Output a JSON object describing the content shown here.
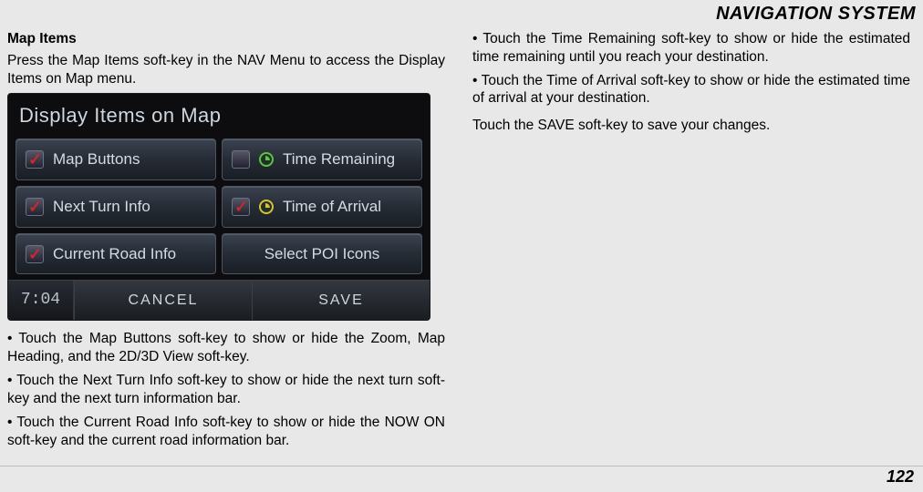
{
  "header": {
    "title": "NAVIGATION SYSTEM"
  },
  "page_number": "122",
  "left": {
    "heading": "Map Items",
    "intro": "Press the Map Items soft-key in the NAV Menu to access the Display Items on Map menu.",
    "b1": "• Touch the Map Buttons soft-key to show or hide the Zoom, Map Heading, and the 2D/3D View soft-key.",
    "b2": "• Touch the Next Turn Info soft-key to show or hide the next turn soft-key and the next turn information bar.",
    "b3": "• Touch the Current Road Info soft-key to show or hide the NOW ON soft-key and the current road information bar."
  },
  "right": {
    "b1": "• Touch the Time Remaining soft-key to show or hide the esti­mated time remaining until you reach your destination.",
    "b2": "• Touch the Time of Arrival soft-key to show or hide the estimated time of arrival at your destination.",
    "b3": "Touch the SAVE soft-key to save your changes."
  },
  "screen": {
    "title": "Display Items on Map",
    "options": {
      "map_buttons": "Map Buttons",
      "time_remaining": "Time Remaining",
      "next_turn": "Next Turn Info",
      "time_arrival": "Time of Arrival",
      "current_road": "Current Road Info",
      "poi": "Select POI Icons"
    },
    "time": "7:04",
    "cancel": "CANCEL",
    "save": "SAVE"
  }
}
